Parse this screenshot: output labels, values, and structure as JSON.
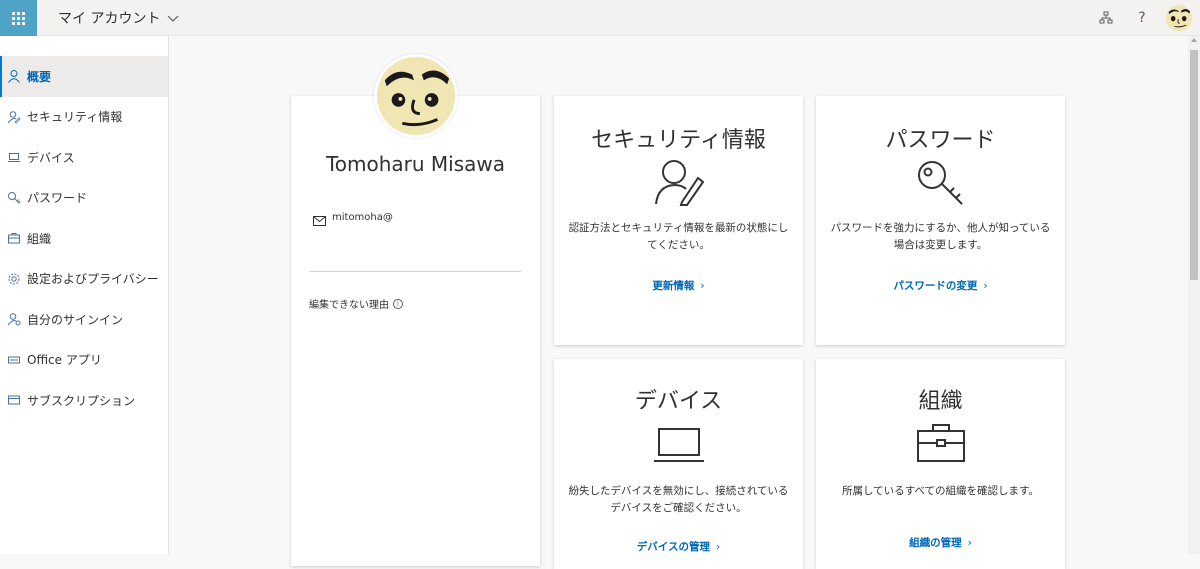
{
  "header": {
    "title": "マイ アカウント",
    "icons": [
      "apps-icon",
      "org-chart-icon",
      "help-icon",
      "avatar"
    ]
  },
  "help_label": "?",
  "sidebar": {
    "items": [
      {
        "label": "概要",
        "icon": "person-icon",
        "active": true
      },
      {
        "label": "セキュリティ情報",
        "icon": "security-person-icon",
        "active": false
      },
      {
        "label": "デバイス",
        "icon": "laptop-icon",
        "active": false
      },
      {
        "label": "パスワード",
        "icon": "key-icon",
        "active": false
      },
      {
        "label": "組織",
        "icon": "briefcase-icon",
        "active": false
      },
      {
        "label": "設定およびプライバシー",
        "icon": "gear-icon",
        "active": false
      },
      {
        "label": "自分のサインイン",
        "icon": "signin-icon",
        "active": false
      },
      {
        "label": "Office アプリ",
        "icon": "office-icon",
        "active": false
      },
      {
        "label": "サブスクリプション",
        "icon": "card-icon",
        "active": false
      }
    ]
  },
  "profile": {
    "name": "Tomoharu Misawa",
    "email": "mitomoha@",
    "note": "編集できない理由",
    "info_glyph": "i"
  },
  "cards": {
    "security": {
      "title": "セキュリティ情報",
      "desc": "認証方法とセキュリティ情報を最新の状態にしてください。",
      "link": "更新情報"
    },
    "password": {
      "title": "パスワード",
      "desc": "パスワードを強力にするか、他人が知っている場合は変更します。",
      "link": "パスワードの変更"
    },
    "devices": {
      "title": "デバイス",
      "desc": "紛失したデバイスを無効にし、接続されているデバイスをご確認ください。",
      "link": "デバイスの管理"
    },
    "organization": {
      "title": "組織",
      "desc": "所属しているすべての組織を確認します。",
      "link": "組織の管理"
    }
  },
  "link_arrow": "›",
  "colors": {
    "accent": "#0067b8",
    "waffle": "#4fa3c7",
    "avatar_bg": "#f0e6b4"
  }
}
